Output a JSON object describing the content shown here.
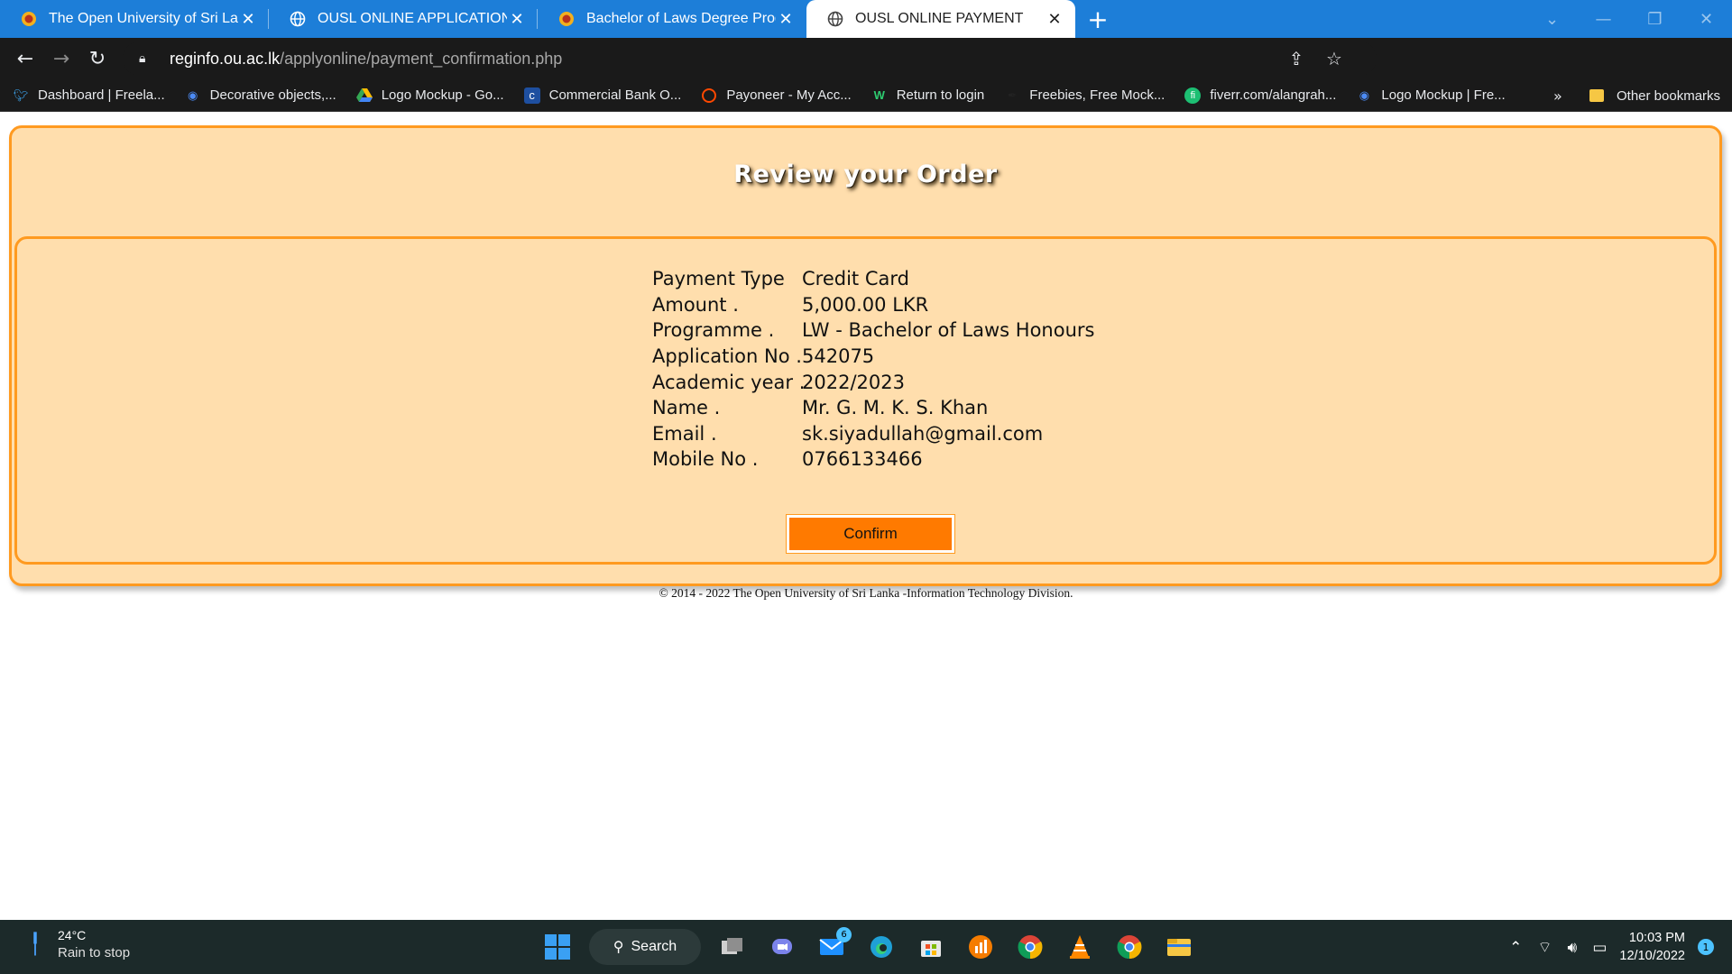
{
  "browser": {
    "tabs": [
      {
        "title": "The Open University of Sri Lanka",
        "icon": "ousl-logo-icon"
      },
      {
        "title": "OUSL ONLINE APPLICATION",
        "icon": "globe-icon"
      },
      {
        "title": "Bachelor of Laws Degree Program",
        "icon": "ousl-logo-icon"
      },
      {
        "title": "OUSL ONLINE PAYMENT",
        "icon": "globe-icon",
        "active": true
      }
    ],
    "url_host": "reginfo.ou.ac.lk",
    "url_path": "/applyonline/payment_confirmation.php",
    "bookmarks": [
      "Dashboard | Freela...",
      "Decorative objects,...",
      "Logo Mockup - Go...",
      "Commercial Bank O...",
      "Payoneer - My Acc...",
      "Return to login",
      "Freebies, Free Mock...",
      "fiverr.com/alangrah...",
      "Logo Mockup | Fre..."
    ],
    "bookmarks_more": "»",
    "other_bookmarks": "Other bookmarks"
  },
  "page": {
    "heading": "Review your Order",
    "details": [
      {
        "label": "Payment Type",
        "value": "Credit Card"
      },
      {
        "label": "Amount .",
        "value": "5,000.00 LKR"
      },
      {
        "label": "Programme .",
        "value": "LW - Bachelor of Laws Honours"
      },
      {
        "label": "Application No .",
        "value": "542075"
      },
      {
        "label": "Academic year .",
        "value": "2022/2023"
      },
      {
        "label": "Name .",
        "value": "Mr. G. M. K. S. Khan"
      },
      {
        "label": "Email .",
        "value": "sk.siyadullah@gmail.com"
      },
      {
        "label": "Mobile No .",
        "value": "0766133466"
      }
    ],
    "confirm_label": "Confirm",
    "footer": "© 2014 - 2022 The Open University of Sri Lanka -Information Technology Division."
  },
  "taskbar": {
    "temperature": "24°C",
    "weather": "Rain to stop",
    "search_label": "Search",
    "mail_badge": "6",
    "time": "10:03 PM",
    "date": "12/10/2022",
    "notification_count": "1"
  },
  "colors": {
    "page_bg": "#ffdead",
    "border": "#ff9a20",
    "confirm_button": "#ff7a00",
    "tabbar": "#1d7ed8"
  }
}
